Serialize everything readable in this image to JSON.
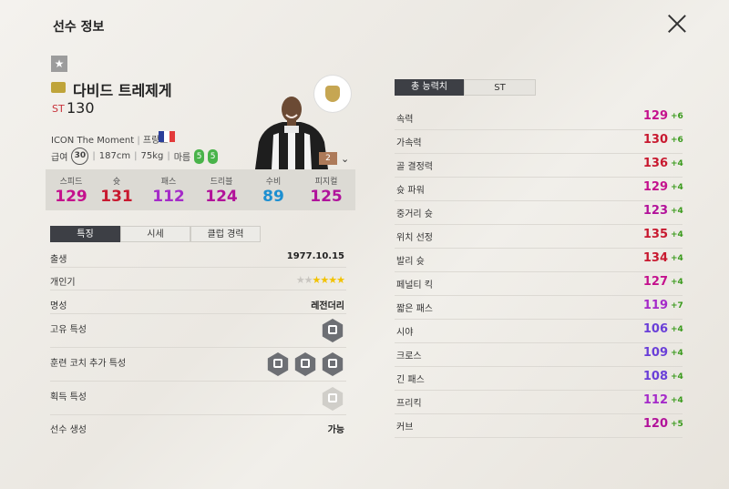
{
  "header": {
    "title": "선수 정보"
  },
  "player": {
    "name": "다비드 트레제게",
    "position": "ST",
    "overall": "130",
    "season": "ICON The Moment",
    "nation": "프랑스",
    "salary_label": "급여",
    "salary": "30",
    "height": "187cm",
    "weight": "75kg",
    "build": "마름",
    "weak_foot_left": "5",
    "weak_foot_right": "5",
    "enhance_level": "2"
  },
  "colors": {
    "flag": [
      "#2b3f9a",
      "#ffffff",
      "#e33a3a"
    ],
    "plus": "#3a9a1c",
    "position": "#c8323a"
  },
  "summary_stats": [
    {
      "label": "스피드",
      "value": "129",
      "color": "#c4118d"
    },
    {
      "label": "슛",
      "value": "131",
      "color": "#c8192f"
    },
    {
      "label": "패스",
      "value": "112",
      "color": "#a52bc9"
    },
    {
      "label": "드리블",
      "value": "124",
      "color": "#b2129a"
    },
    {
      "label": "수비",
      "value": "89",
      "color": "#1c8fd1"
    },
    {
      "label": "피지컬",
      "value": "125",
      "color": "#b0139b"
    }
  ],
  "left_tabs": [
    {
      "label": "특징"
    },
    {
      "label": "시세"
    },
    {
      "label": "클럽 경력"
    }
  ],
  "details": {
    "birth_label": "출생",
    "birth": "1977.10.15",
    "popularity_label": "개인기",
    "popularity_stars": 4,
    "popularity_max": 6,
    "fame_label": "명성",
    "fame": "레전더리",
    "unique_trait_label": "고유 특성",
    "coach_trait_label": "훈련 코치 추가 특성",
    "acquire_trait_label": "획득 특성",
    "generate_label": "선수 생성",
    "generate": "가능"
  },
  "right_tabs": [
    {
      "label": "총 능력치"
    },
    {
      "label": "ST"
    }
  ],
  "attributes": [
    {
      "label": "속력",
      "value": "129",
      "plus": "+6",
      "color": "#c4118d"
    },
    {
      "label": "가속력",
      "value": "130",
      "plus": "+6",
      "color": "#c8192f"
    },
    {
      "label": "골 결정력",
      "value": "136",
      "plus": "+4",
      "color": "#c8192f"
    },
    {
      "label": "슛 파워",
      "value": "129",
      "plus": "+4",
      "color": "#c4118d"
    },
    {
      "label": "중거리 슛",
      "value": "123",
      "plus": "+4",
      "color": "#b2129a"
    },
    {
      "label": "위치 선정",
      "value": "135",
      "plus": "+4",
      "color": "#c8192f"
    },
    {
      "label": "발리 슛",
      "value": "134",
      "plus": "+4",
      "color": "#c8192f"
    },
    {
      "label": "페널티 킥",
      "value": "127",
      "plus": "+4",
      "color": "#c4118d"
    },
    {
      "label": "짧은 패스",
      "value": "119",
      "plus": "+7",
      "color": "#a52bc9"
    },
    {
      "label": "시야",
      "value": "106",
      "plus": "+4",
      "color": "#6a3fd8"
    },
    {
      "label": "크로스",
      "value": "109",
      "plus": "+4",
      "color": "#6a3fd8"
    },
    {
      "label": "긴 패스",
      "value": "108",
      "plus": "+4",
      "color": "#6a3fd8"
    },
    {
      "label": "프리킥",
      "value": "112",
      "plus": "+4",
      "color": "#a52bc9"
    },
    {
      "label": "커브",
      "value": "120",
      "plus": "+5",
      "color": "#b2129a"
    }
  ]
}
